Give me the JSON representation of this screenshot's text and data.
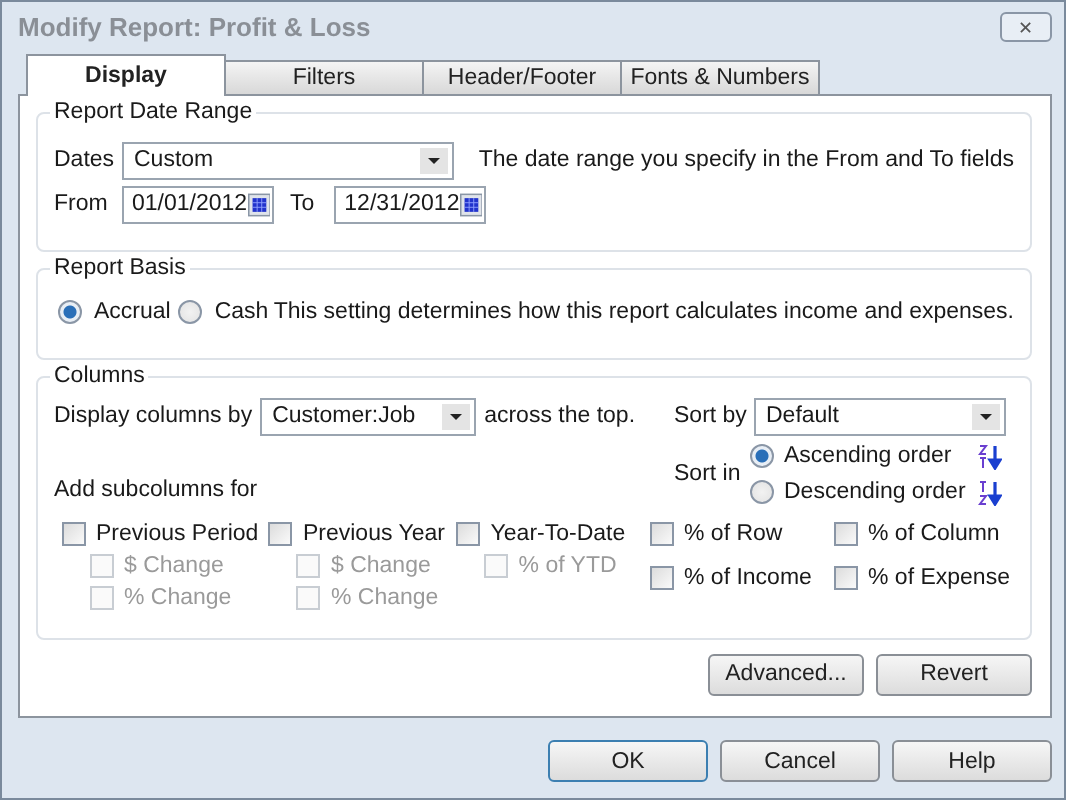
{
  "window": {
    "title": "Modify Report: Profit & Loss",
    "close": "✕"
  },
  "tabs": [
    {
      "label": "Display",
      "selected": true
    },
    {
      "label": "Filters",
      "selected": false
    },
    {
      "label": "Header/Footer",
      "selected": false
    },
    {
      "label": "Fonts & Numbers",
      "selected": false
    }
  ],
  "date_range": {
    "title": "Report Date Range",
    "dates_label": "Dates",
    "dates_value": "Custom",
    "description": "The date range you specify in the From and To fields",
    "from_label": "From",
    "from_value": "01/01/2012",
    "to_label": "To",
    "to_value": "12/31/2012"
  },
  "basis": {
    "title": "Report Basis",
    "options": [
      {
        "label": "Accrual",
        "selected": true
      },
      {
        "label": "Cash",
        "selected": false
      }
    ],
    "description": "This setting determines how this report calculates income and expenses."
  },
  "columns": {
    "title": "Columns",
    "display_label": "Display columns by",
    "display_value": "Customer:Job",
    "display_suffix": "across the top.",
    "sort_by_label": "Sort by",
    "sort_by_value": "Default",
    "sort_in_label": "Sort in",
    "sort_orders": [
      {
        "label": "Ascending order",
        "selected": true,
        "kind": "ascending"
      },
      {
        "label": "Descending order",
        "selected": false,
        "kind": "descending"
      }
    ],
    "subcolumns_label": "Add subcolumns for",
    "subcolumns": [
      {
        "label": "Previous Period",
        "checked": false,
        "children": [
          {
            "label": "$ Change",
            "checked": false,
            "disabled": true
          },
          {
            "label": "% Change",
            "checked": false,
            "disabled": true
          }
        ]
      },
      {
        "label": "Previous Year",
        "checked": false,
        "children": [
          {
            "label": "$ Change",
            "checked": false,
            "disabled": true
          },
          {
            "label": "% Change",
            "checked": false,
            "disabled": true
          }
        ]
      },
      {
        "label": "Year-To-Date",
        "checked": false,
        "children": [
          {
            "label": "% of YTD",
            "checked": false,
            "disabled": true
          }
        ]
      }
    ],
    "percent_options": [
      {
        "label": "% of Row",
        "checked": false
      },
      {
        "label": "% of Column",
        "checked": false
      },
      {
        "label": "% of Income",
        "checked": false
      },
      {
        "label": "% of Expense",
        "checked": false
      }
    ]
  },
  "panel_buttons": [
    "Advanced...",
    "Revert"
  ],
  "buttons": [
    {
      "label": "OK",
      "default": true
    },
    {
      "label": "Cancel",
      "default": false
    },
    {
      "label": "Help",
      "default": false
    }
  ]
}
